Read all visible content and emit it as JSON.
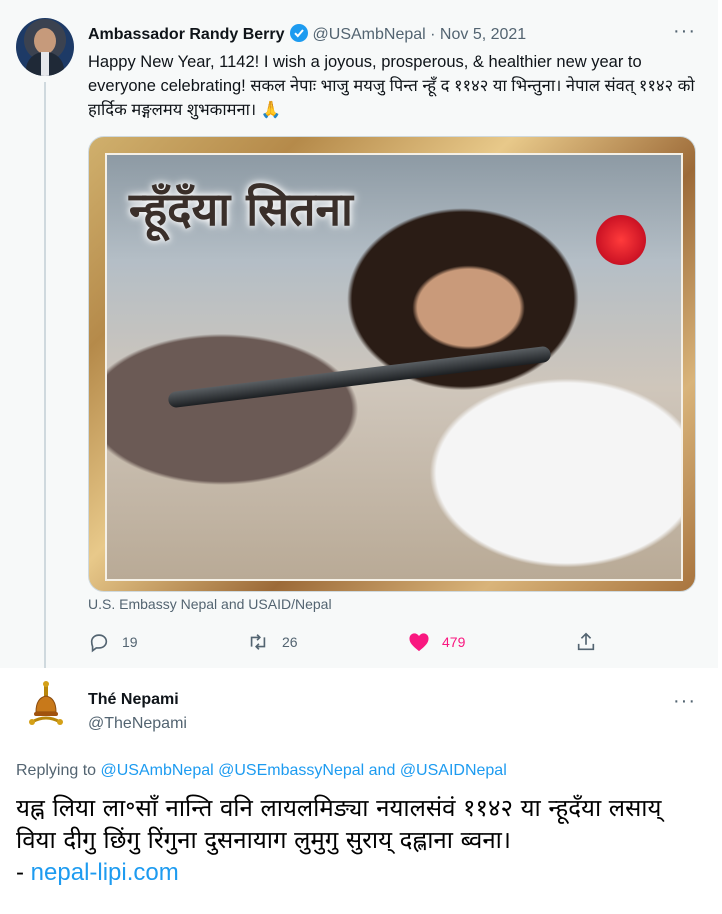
{
  "tweet1": {
    "name": "Ambassador Randy Berry",
    "handle": "@USAmbNepal",
    "sep": "·",
    "date": "Nov 5, 2021",
    "more": "···",
    "text": "Happy New Year, 1142! I wish a joyous, prosperous, & healthier new year to everyone celebrating! सकल नेपाः भाजु मयजु पिन्त न्हूँ द ११४२ या भिन्तुना। नेपाल संवत् ११४२ को हार्दिक मङ्गलमय शुभकामना। 🙏",
    "image_overlay_text": "न्हूँदँया सितना",
    "caption": "U.S. Embassy Nepal and USAID/Nepal",
    "actions": {
      "reply_count": "19",
      "retweet_count": "26",
      "like_count": "479"
    },
    "colors": {
      "like": "#f91880",
      "verified": "#1d9bf0",
      "muted": "#536471"
    }
  },
  "tweet2": {
    "name": "Thé Nepami",
    "handle": "@TheNepami",
    "more": "···",
    "replying_label": "Replying to",
    "reply_mentions": [
      "@USAmbNepal",
      "@USEmbassyNepal",
      "and",
      "@USAIDNepal"
    ],
    "text": "यह्न लिया ला॰साँ नान्ति वनि लायलमिङ्या नयालसंवं ११४२ या न्हूदँया लसाय् विया दीगु छिंगु रिंगुना दुसनायाग लुमुगु सुराय् दह्लाना ब्वना।",
    "link_prefix": "- ",
    "link_text": "nepal-lipi.com"
  }
}
